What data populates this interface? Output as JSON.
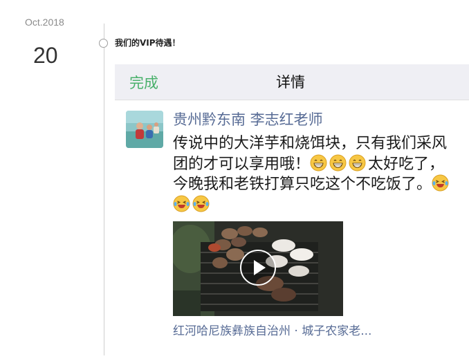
{
  "timeline": {
    "month": "Oct.2018",
    "day": "20",
    "title": "我们的VIP待遇！"
  },
  "screenshot": {
    "nav": {
      "done_label": "完成",
      "title": "详情",
      "done_color": "#48b06a"
    },
    "author": {
      "name": "贵州黔东南 李志红老师",
      "avatar_icon": "avatar-photo",
      "name_color": "#576b95"
    },
    "post": {
      "text_part1": "传说中的大洋芋和烧饵块，只有我们采风团的才可以享用哦！",
      "emoji_group1": "grin-emoji",
      "text_part2": "太好吃了，今晚我和老铁打算只吃这个不吃饭了。",
      "emoji_group2": "laugh-tears-emoji"
    },
    "video": {
      "play_icon": "play-icon"
    },
    "location": "红河哈尼族彝族自治州 · 城子农家老..."
  }
}
